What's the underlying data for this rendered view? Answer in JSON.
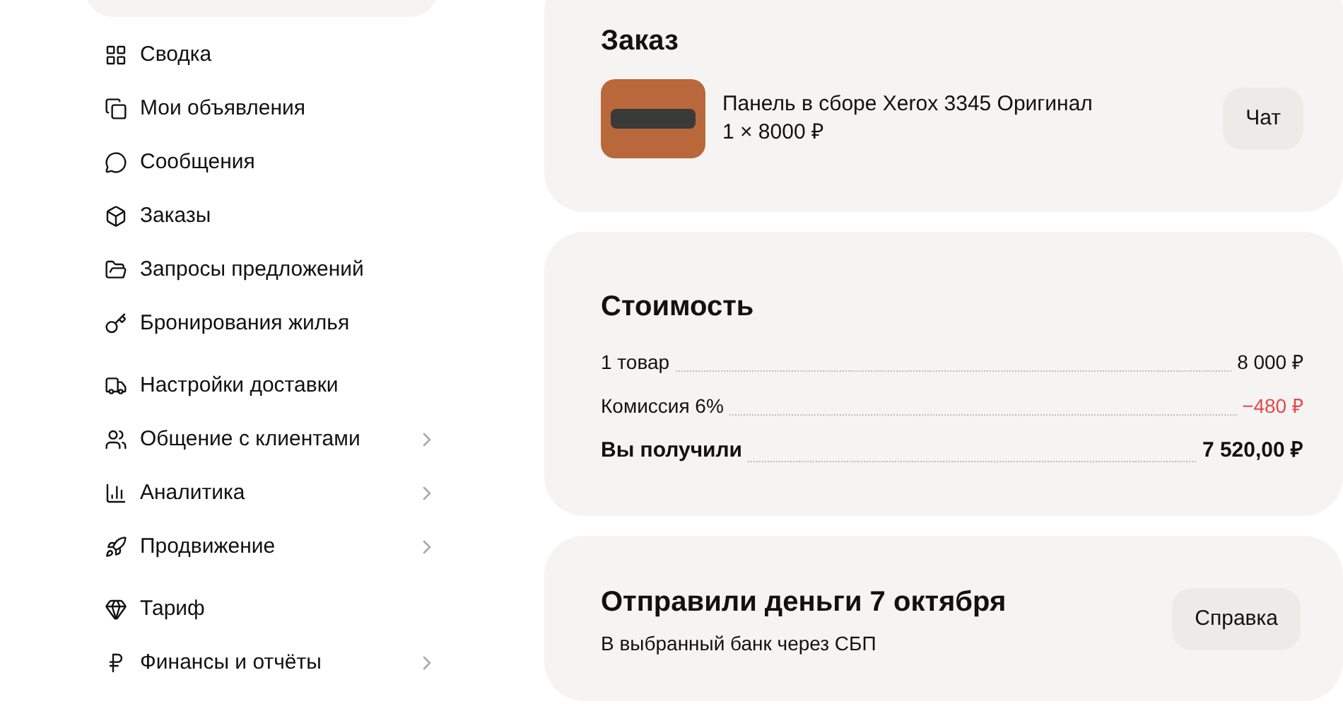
{
  "sidebar": {
    "groups": [
      [
        {
          "label": "Сводка",
          "expandable": false
        },
        {
          "label": "Мои объявления",
          "expandable": false
        },
        {
          "label": "Сообщения",
          "expandable": false
        },
        {
          "label": "Заказы",
          "expandable": false
        },
        {
          "label": "Запросы предложений",
          "expandable": false
        },
        {
          "label": "Бронирования жилья",
          "expandable": false
        }
      ],
      [
        {
          "label": "Настройки доставки",
          "expandable": false
        },
        {
          "label": "Общение с клиентами",
          "expandable": true
        },
        {
          "label": "Аналитика",
          "expandable": true
        },
        {
          "label": "Продвижение",
          "expandable": true
        }
      ],
      [
        {
          "label": "Тариф",
          "expandable": false
        },
        {
          "label": "Финансы и отчёты",
          "expandable": true
        }
      ]
    ]
  },
  "order": {
    "title": "Заказ",
    "item": {
      "name": "Панель в сборе Xerox 3345 Оригинал",
      "quantity_price": "1 × 8000 ₽"
    },
    "chat_button": "Чат"
  },
  "cost": {
    "title": "Стоимость",
    "rows": [
      {
        "kind": "normal",
        "label": "1 товар",
        "value": "8 000 ₽"
      },
      {
        "kind": "negative",
        "label": "Комиссия 6%",
        "value": "−480 ₽"
      },
      {
        "kind": "total",
        "label": "Вы получили",
        "value": "7 520,00 ₽"
      }
    ]
  },
  "payout": {
    "title": "Отправили деньги 7 октября",
    "subtitle": "В выбранный банк через СБП",
    "help_button": "Справка"
  }
}
